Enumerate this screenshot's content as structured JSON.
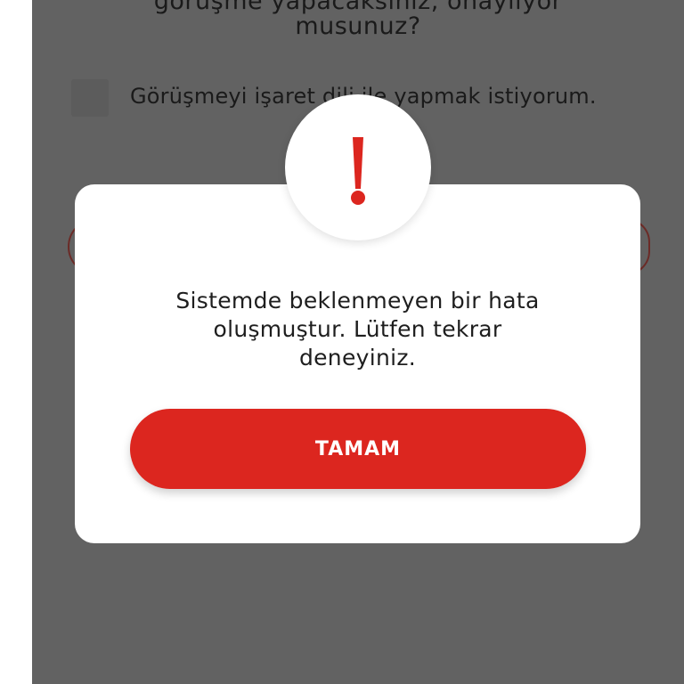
{
  "background": {
    "question_line1": "görüşme yapacaksınız, onaylıyor",
    "question_line2": "musunuz?",
    "consent_label": "Görüşmeyi işaret dili ile yapmak istiyorum."
  },
  "dialog": {
    "icon": "exclamation-icon",
    "message_line1": "Sistemde beklenmeyen bir hata",
    "message_line2": "oluşmuştur. Lütfen tekrar",
    "message_line3": "deneyiniz.",
    "ok_label": "TAMAM"
  },
  "colors": {
    "accent": "#dc261f",
    "overlay": "#626262",
    "dialog_bg": "#ffffff"
  }
}
